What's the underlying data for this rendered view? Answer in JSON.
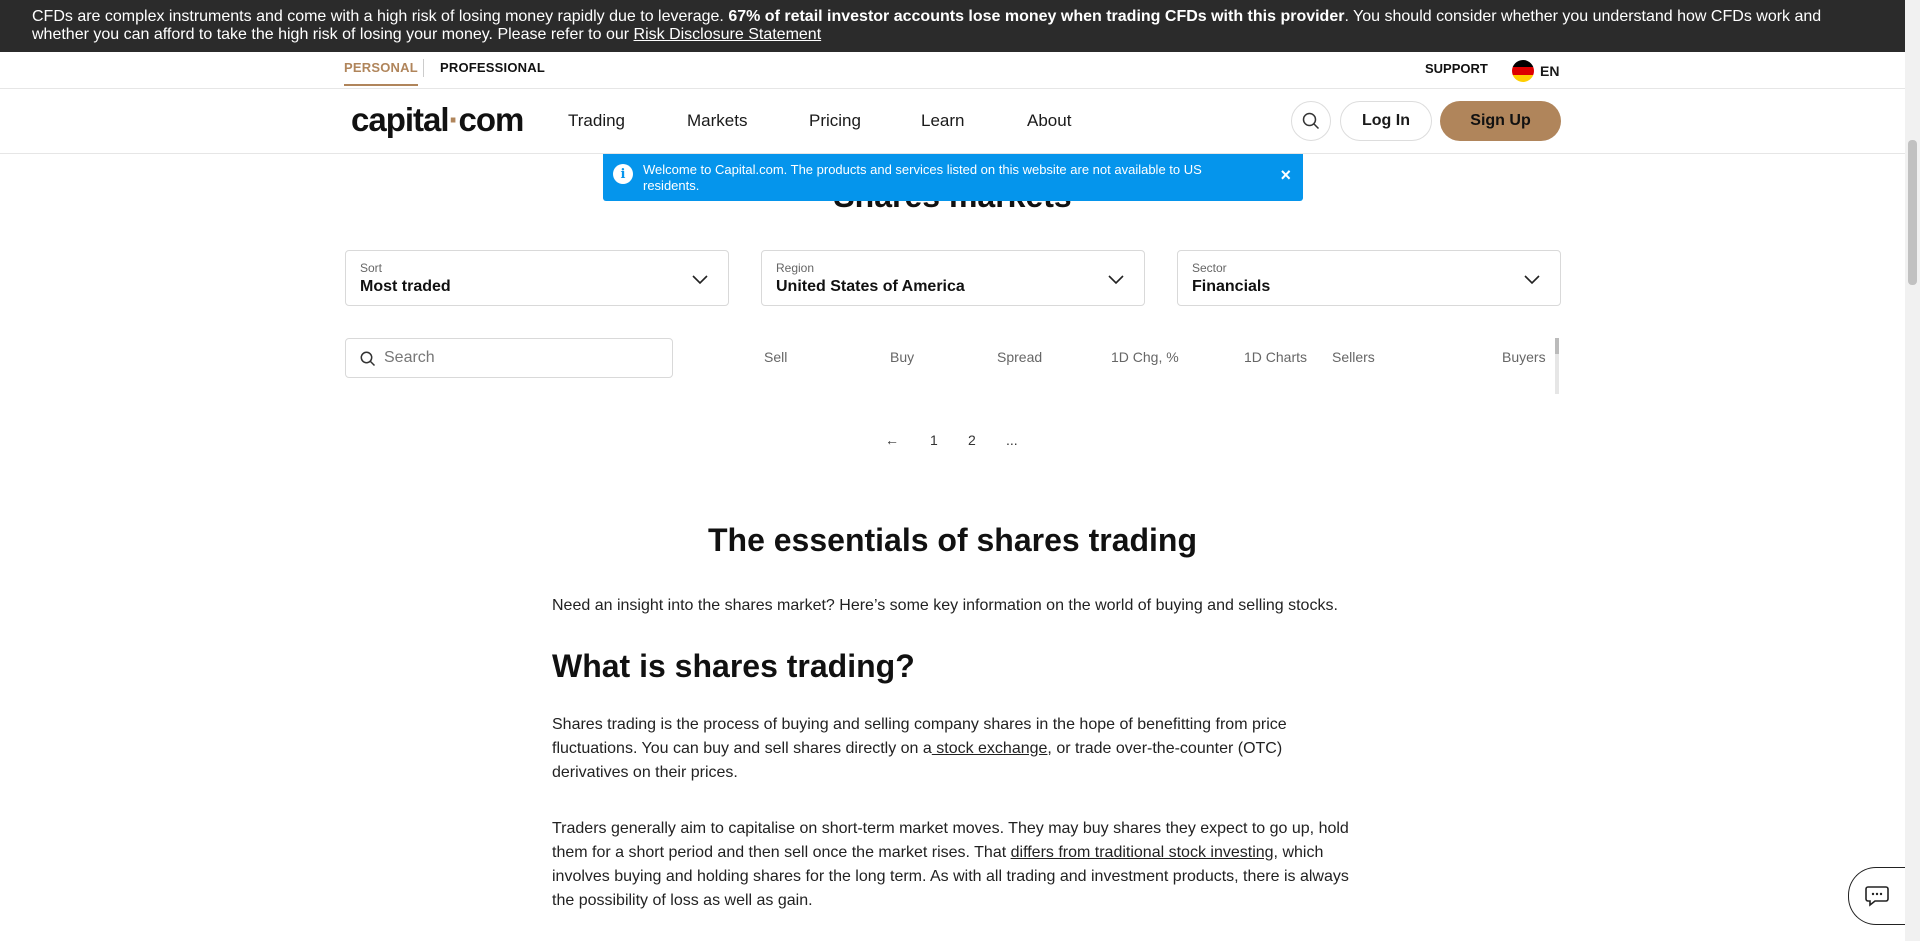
{
  "risk_banner": {
    "text_before": "CFDs are complex instruments and come with a high risk of losing money rapidly due to leverage. ",
    "text_bold": "67% of retail investor accounts lose money when trading CFDs with this provider",
    "text_after": ". You should consider whether you understand how CFDs work and whether you can afford to take the high risk of losing your money. Please refer to our ",
    "link": "Risk Disclosure Statement"
  },
  "top_strip": {
    "personal": "PERSONAL",
    "professional": "PROFESSIONAL",
    "support": "SUPPORT",
    "lang": "EN"
  },
  "nav": {
    "logo_left": "capital",
    "logo_dot": "·",
    "logo_right": "com",
    "items": [
      "Trading",
      "Markets",
      "Pricing",
      "Learn",
      "About"
    ],
    "login": "Log In",
    "signup": "Sign Up"
  },
  "toast": {
    "text": "Welcome to Capital.com. The products and services listed on this website are not available to US residents.",
    "icon": "i",
    "close": "×"
  },
  "section_title": "Shares markets",
  "filters": [
    {
      "label": "Sort",
      "value": "Most traded"
    },
    {
      "label": "Region",
      "value": "United States of America"
    },
    {
      "label": "Sector",
      "value": "Financials"
    }
  ],
  "table": {
    "search_placeholder": "Search",
    "columns": [
      "Sell",
      "Buy",
      "Spread",
      "1D Chg, %",
      "1D Charts",
      "Sellers",
      "Buyers"
    ]
  },
  "pagination": {
    "prev": "←",
    "pages": [
      "1",
      "2",
      "..."
    ]
  },
  "article": {
    "title": "The essentials of shares trading",
    "intro": "Need an insight into the shares market? Here’s some key information on the world of buying and selling stocks.",
    "h2": "What is shares trading?",
    "p1_a": "Shares trading is the process of buying and selling company shares in the hope of benefitting from price fluctuations. You can buy and sell shares directly on a",
    "p1_link": " stock exchange",
    "p1_b": ", or trade over-the-counter (OTC) derivatives on their prices.",
    "p2_a": "Traders generally aim to capitalise on short-term market moves. They may buy shares they expect to go up, hold them for a short period and then sell once the market rises. That ",
    "p2_link": "differs from traditional stock investing",
    "p2_b": ", which involves buying and holding shares for the long term. As with all trading and investment products, there is always the possibility of loss as well as gain."
  },
  "colors": {
    "accent": "#b0855b",
    "toast": "#0595ec",
    "banner": "#2b2b2b"
  }
}
